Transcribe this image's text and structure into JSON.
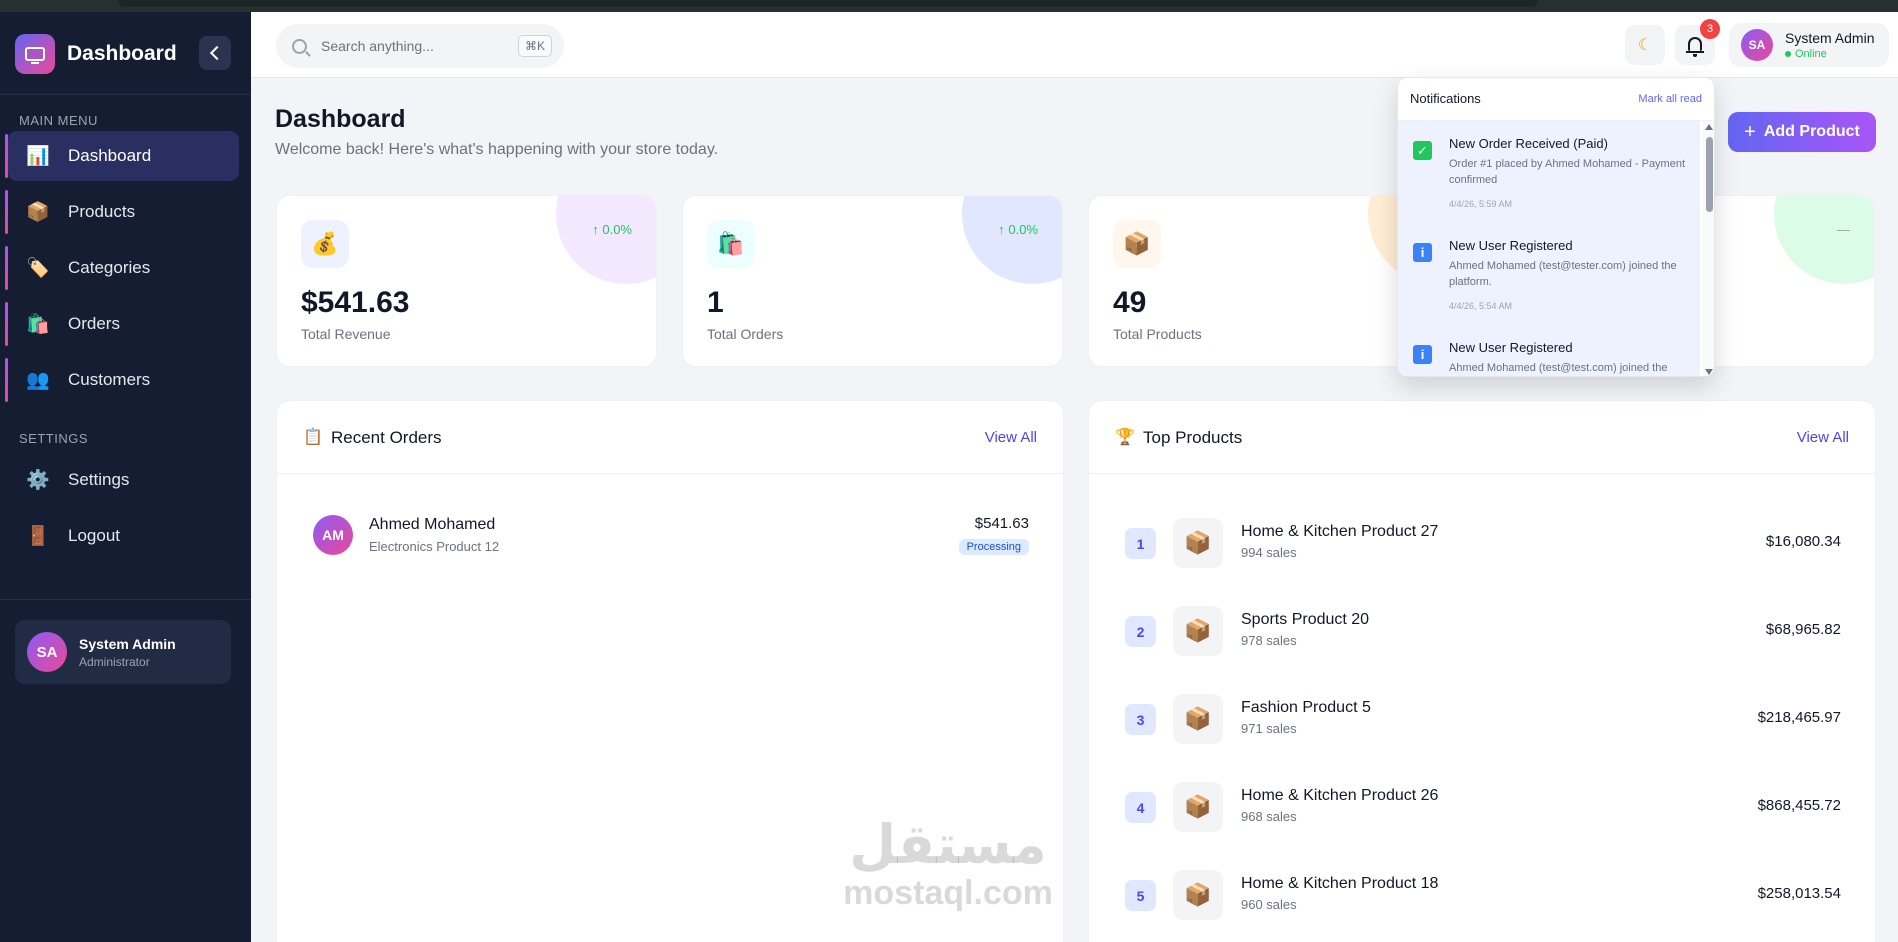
{
  "sidebar": {
    "brand": "Dashboard",
    "main_menu_label": "MAIN MENU",
    "items": [
      {
        "label": "Dashboard",
        "icon": "chart-icon",
        "glyph": "📊"
      },
      {
        "label": "Products",
        "icon": "package-icon",
        "glyph": "📦"
      },
      {
        "label": "Categories",
        "icon": "tag-icon",
        "glyph": "🏷️"
      },
      {
        "label": "Orders",
        "icon": "shopping-bags-icon",
        "glyph": "🛍️"
      },
      {
        "label": "Customers",
        "icon": "users-icon",
        "glyph": "👥"
      }
    ],
    "settings_label": "SETTINGS",
    "settings_items": [
      {
        "label": "Settings",
        "icon": "gear-icon",
        "glyph": "⚙️"
      },
      {
        "label": "Logout",
        "icon": "door-icon",
        "glyph": "🚪"
      }
    ],
    "user": {
      "initials": "SA",
      "name": "System Admin",
      "role": "Administrator"
    }
  },
  "header": {
    "search_placeholder": "Search anything...",
    "shortcut": "⌘K",
    "notification_count": "3",
    "user": {
      "initials": "SA",
      "name": "System Admin",
      "status": "Online"
    }
  },
  "page": {
    "title": "Dashboard",
    "subtitle": "Welcome back! Here's what's happening with your store today.",
    "add_button": "Add Product"
  },
  "stats": [
    {
      "value": "$541.63",
      "label": "Total Revenue",
      "change": "↑ 0.0%",
      "glyph": "💰"
    },
    {
      "value": "1",
      "label": "Total Orders",
      "change": "↑ 0.0%",
      "glyph": "🛍️"
    },
    {
      "value": "49",
      "label": "Total Products",
      "change": "",
      "glyph": "📦"
    },
    {
      "value": "",
      "label": "",
      "change": "—",
      "glyph": ""
    }
  ],
  "recent_orders": {
    "title": "Recent Orders",
    "view_all": "View All",
    "rows": [
      {
        "initials": "AM",
        "name": "Ahmed Mohamed",
        "product": "Electronics Product 12",
        "amount": "$541.63",
        "status": "Processing"
      }
    ]
  },
  "top_products": {
    "title": "Top Products",
    "view_all": "View All",
    "rows": [
      {
        "rank": "1",
        "name": "Home & Kitchen Product 27",
        "sales": "994 sales",
        "revenue": "$16,080.34"
      },
      {
        "rank": "2",
        "name": "Sports Product 20",
        "sales": "978 sales",
        "revenue": "$68,965.82"
      },
      {
        "rank": "3",
        "name": "Fashion Product 5",
        "sales": "971 sales",
        "revenue": "$218,465.97"
      },
      {
        "rank": "4",
        "name": "Home & Kitchen Product 26",
        "sales": "968 sales",
        "revenue": "$868,455.72"
      },
      {
        "rank": "5",
        "name": "Home & Kitchen Product 18",
        "sales": "960 sales",
        "revenue": "$258,013.54"
      }
    ]
  },
  "notifications": {
    "title": "Notifications",
    "mark_all": "Mark all read",
    "items": [
      {
        "title": "New Order Received (Paid)",
        "message": "Order #1 placed by Ahmed Mohamed - Payment confirmed",
        "date": "4/4/26, 5:59 AM",
        "icon": "check-icon",
        "color": "#22c55e"
      },
      {
        "title": "New User Registered",
        "message": "Ahmed Mohamed (test@tester.com) joined the platform.",
        "date": "4/4/26, 5:54 AM",
        "icon": "info-icon",
        "color": "#3b82f6"
      },
      {
        "title": "New User Registered",
        "message": "Ahmed Mohamed (test@test.com) joined the",
        "date": "",
        "icon": "info-icon",
        "color": "#3b82f6"
      }
    ]
  },
  "watermark": {
    "arabic": "مستقل",
    "latin": "mostaql.com"
  },
  "colors": {
    "accent": "#6366f1",
    "sidebar": "#151d33",
    "success": "#22c55e",
    "danger": "#ef4444"
  }
}
